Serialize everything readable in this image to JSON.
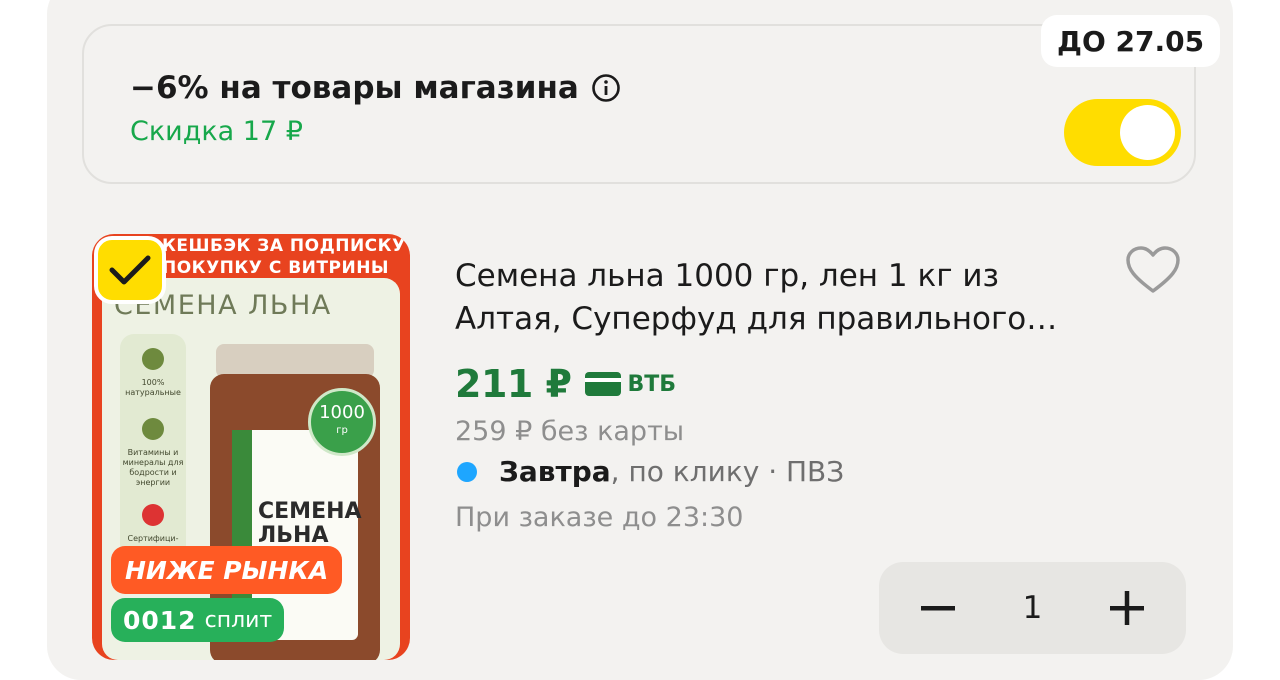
{
  "promo": {
    "title": "−6% на товары магазина",
    "discount": "Скидка 17 ₽",
    "deadline": "ДО 27.05",
    "toggle_on": true
  },
  "product": {
    "image": {
      "banner_line1": "КЕШБЭК ЗА ПОДПИСКУ",
      "banner_line2": "ПОКУПКУ С ВИТРИНЫ",
      "title": "СЕМЕНА ЛЬНА",
      "features": [
        "100% натуральные",
        "Витамины и минералы для бодрости и энергии",
        "Сертифици-"
      ],
      "jar_label": "СЕМЕНА ЛЬНА",
      "badge_value": "1000",
      "badge_unit": "гр",
      "tag_below_market": "НИЖЕ РЫНКА",
      "split_amount": "0012",
      "split_word": "сплит",
      "selected": true
    },
    "title": "Семена льна 1000 гр, лен 1 кг из Алтая, Суперфуд для правильного…",
    "price": "211 ₽",
    "bank": "ВТБ",
    "old_price": "259 ₽  без карты",
    "delivery_day": "Завтра",
    "delivery_rest": ", по клику · ПВЗ",
    "order_time": "При заказе до 23:30",
    "quantity": "1"
  },
  "colors": {
    "accent_yellow": "#ffdd00",
    "price_green": "#1f7a3b",
    "discount_green": "#17a84b",
    "delivery_blue": "#1ea6ff"
  }
}
